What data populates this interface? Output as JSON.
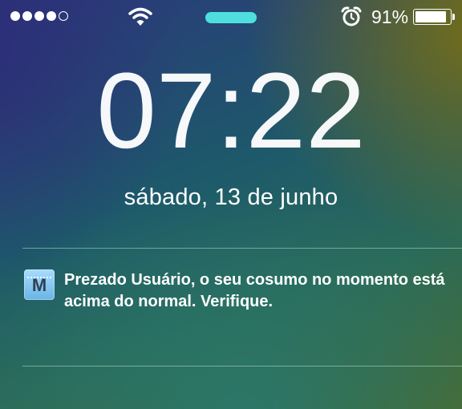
{
  "status_bar": {
    "signal": {
      "filled": 4,
      "total": 5
    },
    "wifi_icon": "wifi-icon",
    "indicator_pill_color": "#4fdede",
    "alarm_icon": "alarm-clock-icon",
    "battery_percent": "91%",
    "battery_level": 0.91
  },
  "lock_screen": {
    "time": "07:22",
    "date": "sábado, 13 de junho"
  },
  "notification": {
    "app_icon_letter": "M",
    "message": "Prezado Usuário, o seu cosumo no momento está acima do normal. Verifique."
  }
}
